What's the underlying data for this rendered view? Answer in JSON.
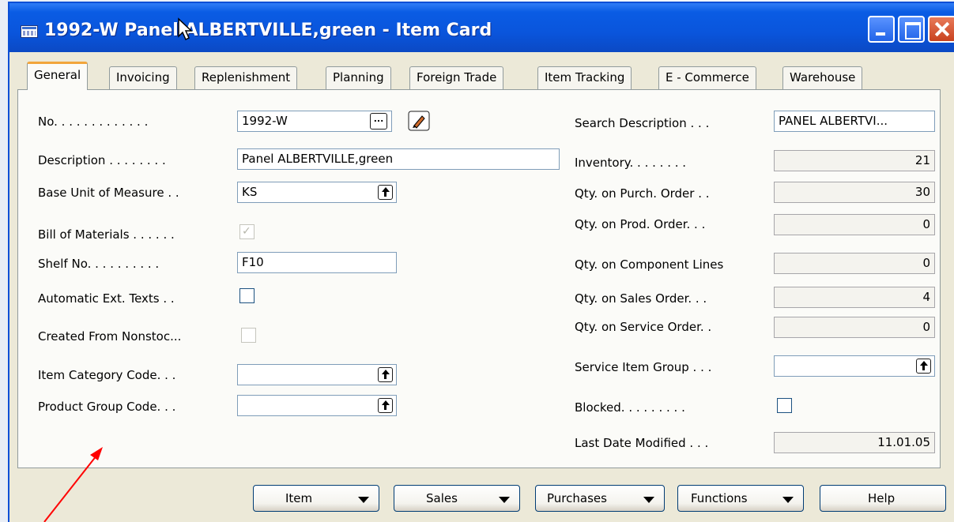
{
  "window": {
    "title": "1992-W Panel ALBERTVILLE,green - Item Card"
  },
  "tabs": [
    {
      "label": "General",
      "active": true
    },
    {
      "label": "Invoicing"
    },
    {
      "label": "Replenishment"
    },
    {
      "label": "Planning"
    },
    {
      "label": "Foreign Trade"
    },
    {
      "label": "Item Tracking"
    },
    {
      "label": "E - Commerce"
    },
    {
      "label": "Warehouse"
    }
  ],
  "left": {
    "no_label": "No. . . . . . . . . . . . .",
    "no_value": "1992-W",
    "description_label": "Description . . . . . . . .",
    "description_value": "Panel ALBERTVILLE,green",
    "base_unit_label": "Base Unit of Measure . .",
    "base_unit_value": "KS",
    "bom_label": "Bill of Materials . . . . . .",
    "bom_checked": true,
    "shelf_label": "Shelf No. . . . . . . . . .",
    "shelf_value": "F10",
    "auto_ext_label": "Automatic Ext. Texts . .",
    "auto_ext_checked": false,
    "created_from_label": "Created From Nonstoc...",
    "item_category_label": "Item Category Code. . .",
    "item_category_value": "",
    "product_group_label": "Product Group Code. . .",
    "product_group_value": ""
  },
  "right": {
    "search_desc_label": "Search Description . . .",
    "search_desc_value": "PANEL ALBERTVI...",
    "inventory_label": "Inventory. . . . . . . .",
    "inventory_value": "21",
    "qty_purch_label": "Qty. on Purch. Order . .",
    "qty_purch_value": "30",
    "qty_prod_label": "Qty. on Prod. Order. . .",
    "qty_prod_value": "0",
    "qty_comp_label": "Qty. on Component Lines",
    "qty_comp_value": "0",
    "qty_sales_label": "Qty. on Sales Order. . .",
    "qty_sales_value": "4",
    "qty_service_label": "Qty. on Service Order. .",
    "qty_service_value": "0",
    "service_group_label": "Service Item Group . . .",
    "service_group_value": "",
    "blocked_label": "Blocked. . . . . . . . .",
    "blocked_checked": false,
    "last_modified_label": "Last Date Modified . . .",
    "last_modified_value": "11.01.05"
  },
  "buttons": {
    "item": "Item",
    "sales": "Sales",
    "purchases": "Purchases",
    "functions": "Functions",
    "help": "Help"
  },
  "colors": {
    "title_bar": "#0a55dc",
    "tab_active_accent": "#f2a53b",
    "annotation_arrow": "#ff0000"
  }
}
